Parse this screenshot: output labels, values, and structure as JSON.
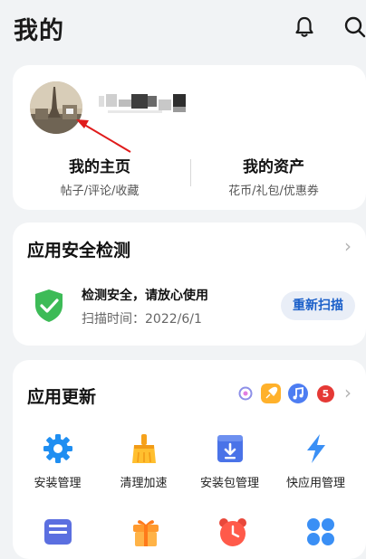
{
  "header": {
    "title": "我的"
  },
  "profile": {
    "stats": [
      {
        "title": "我的主页",
        "subtitle": "帖子/评论/收藏"
      },
      {
        "title": "我的资产",
        "subtitle": "花币/礼包/优惠券"
      }
    ]
  },
  "security": {
    "title": "应用安全检测",
    "status": "检测安全，请放心使用",
    "scan_time": "扫描时间：2022/6/1",
    "rescan_label": "重新扫描"
  },
  "updates": {
    "title": "应用更新",
    "badge_count": "5",
    "tools": [
      {
        "label": "安装管理",
        "icon": "gear-icon"
      },
      {
        "label": "清理加速",
        "icon": "broom-icon"
      },
      {
        "label": "安装包管理",
        "icon": "package-download-icon"
      },
      {
        "label": "快应用管理",
        "icon": "lightning-icon"
      }
    ]
  },
  "colors": {
    "accent": "#1a5fc9",
    "shield_green": "#3dbb57",
    "badge_red": "#e53935"
  }
}
